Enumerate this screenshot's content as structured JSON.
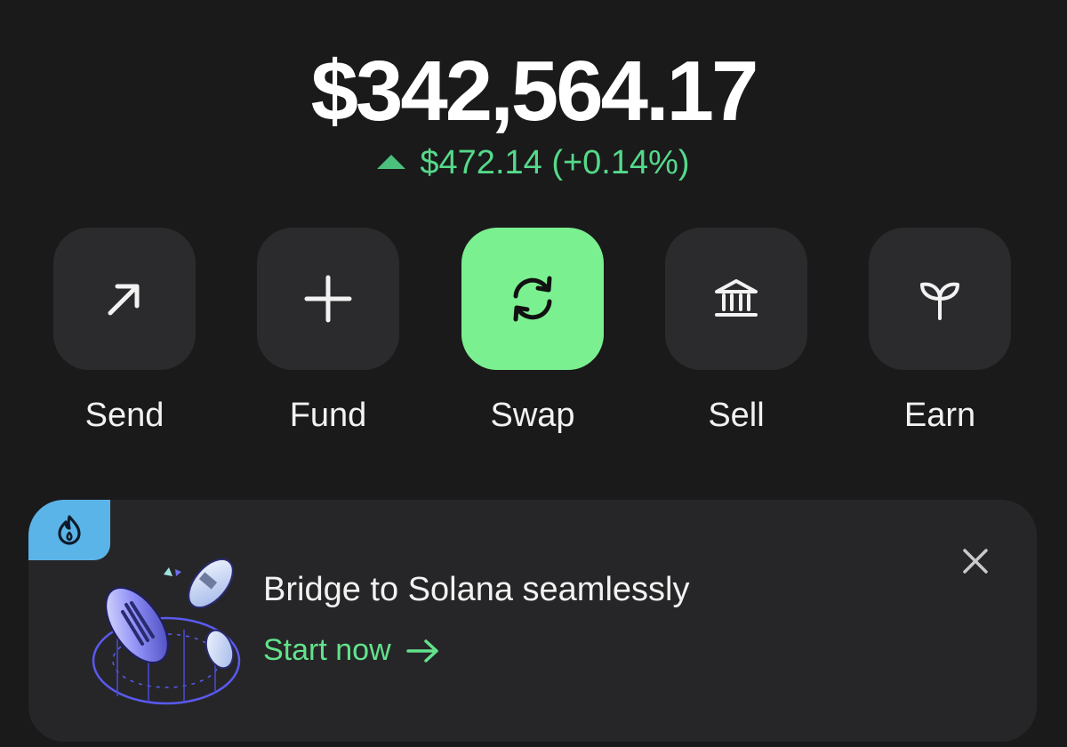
{
  "balance": {
    "total": "$342,564.17",
    "change_text": "$472.14 (+0.14%)",
    "direction_icon": "triangle-up-icon",
    "change_color": "#55d98a"
  },
  "actions": [
    {
      "label": "Send",
      "icon": "arrow-up-right-icon"
    },
    {
      "label": "Fund",
      "icon": "plus-icon"
    },
    {
      "label": "Swap",
      "icon": "swap-icon",
      "accent": "#7bf090"
    },
    {
      "label": "Sell",
      "icon": "bank-icon"
    },
    {
      "label": "Earn",
      "icon": "sprout-icon"
    }
  ],
  "banner": {
    "badge_icon": "flame-icon",
    "title": "Bridge to Solana seamlessly",
    "cta_label": "Start now",
    "cta_icon": "arrow-right-icon",
    "close_icon": "close-icon"
  },
  "colors": {
    "background": "#1a1a1b",
    "tile": "#2b2b2d",
    "accent_green": "#7bf090",
    "badge_blue": "#5bb4e8"
  }
}
